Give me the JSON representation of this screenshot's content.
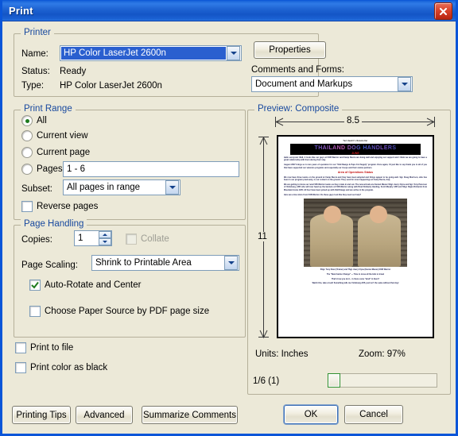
{
  "window": {
    "title": "Print",
    "close_icon": "close-icon"
  },
  "printer": {
    "legend": "Printer",
    "name_label": "Name:",
    "name_value": "HP Color LaserJet 2600n",
    "status_label": "Status:",
    "status_value": "Ready",
    "type_label": "Type:",
    "type_value": "HP Color LaserJet 2600n",
    "properties_button": "Properties",
    "comments_label": "Comments and Forms:",
    "comments_value": "Document and Markups"
  },
  "print_range": {
    "legend": "Print Range",
    "options": [
      {
        "label": "All",
        "selected": true
      },
      {
        "label": "Current view",
        "selected": false
      },
      {
        "label": "Current page",
        "selected": false
      },
      {
        "label": "Pages",
        "selected": false
      }
    ],
    "pages_value": "1 - 6",
    "subset_label": "Subset:",
    "subset_value": "All pages in range",
    "reverse_label": "Reverse pages",
    "reverse_checked": false
  },
  "page_handling": {
    "legend": "Page Handling",
    "copies_label": "Copies:",
    "copies_value": "1",
    "collate_label": "Collate",
    "collate_checked": false,
    "collate_disabled": true,
    "scaling_label": "Page Scaling:",
    "scaling_value": "Shrink to Printable Area",
    "auto_rotate_label": "Auto-Rotate and Center",
    "auto_rotate_checked": true,
    "paper_source_label": "Choose Paper Source by PDF page size",
    "paper_source_checked": false
  },
  "extra_options": {
    "print_to_file_label": "Print to file",
    "print_to_file_checked": false,
    "print_color_as_black_label": "Print color as black",
    "print_color_as_black_checked": false
  },
  "preview": {
    "legend": "Preview: Composite",
    "width_dimension": "8.5",
    "height_dimension": "11",
    "units_label": "Units: Inches",
    "zoom_label": "Zoom:  97%",
    "page_indicator": "1/6 (1)",
    "document": {
      "kicker": "Ted Hewitt's Newsletter",
      "banner_title": "THAILAND DOG HANDLERS",
      "banner_subtitle": "JUNE",
      "paragraph_1": "Hello everyone!  Well, it looks like our guys at FOB Warrior and Camp Bucca are doing well and enjoying our support and I think we are going to have a great relationship with them during their stay.",
      "paragraph_2": "August 2007 brings us to two years of operation for our \"Odd Dawgs & Pups K-9 Supply\" program.  Once again, I'd just like to say thank you to all of you that have supported our veterans programs and especially our troops and their canine partners.",
      "section_heading": "Area of Operations Status",
      "paragraph_3": "We now have three teams on the ground at Camp Bucca and they have been adopted and things appear to be going well.  Sgt. Doug Morrison, who has been in our program previously, is our contact on the ground.  They send for more happenings at Camp Bucca, Iraq.",
      "paragraph_4": "We are getting to know our new FOB Warrior teams as they rotate in and out.  The new arrivals are Kennel Master SSgt. Avery Clyne and Sgt. Tony Peterson of Vicksburg, AFB who will now head up the kennels at FOB Warrior along with Brad Kimberly Harding, Scott Murphy AFB and SSgt. Rejan Richards from Mountain Home AFB.  All four have been joined up with Odd Dawgs and are active in the program.",
      "closing_line": "Here are a few shots from FOB Warrior.  Do these guys look like they need our help?",
      "photo_caption_1": "SSgt. Tony Peter (Trainer) and TSgt. Avery Clyne (Kennel Master) FOB Warrior",
      "photo_caption_2": "The \"New Canine Change\" — Time to move all the kids to travel",
      "photo_caption_3": "That's how you do it... Is there some \"devil\" in them?",
      "photo_caption_4": "Watch this, take a look!  Something tells me Vicksburg AFB, just isn't the same without that dog!"
    }
  },
  "footer": {
    "printing_tips_button": "Printing Tips",
    "advanced_button": "Advanced",
    "summarize_comments_button": "Summarize Comments",
    "ok_button": "OK",
    "cancel_button": "Cancel"
  },
  "colors": {
    "titlebar_blue": "#1e63d2",
    "dialog_bg": "#ece9d8",
    "group_legend": "#17489e",
    "selection_blue": "#2a5fcf",
    "close_red": "#d9432a",
    "check_green": "#1d7a1d"
  }
}
